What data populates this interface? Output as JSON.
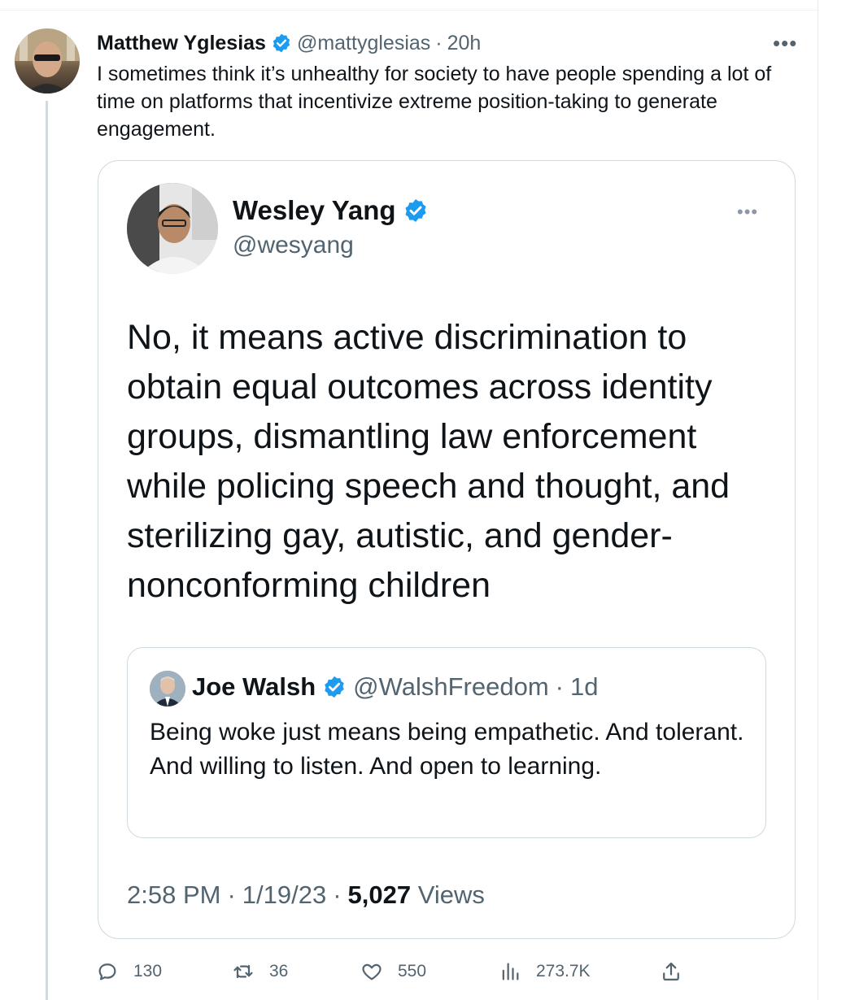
{
  "tweet": {
    "author_name": "Matthew Yglesias",
    "author_handle": "@mattyglesias",
    "separator": "·",
    "time_ago": "20h",
    "more": "•••",
    "text": "I sometimes think it’s unhealthy for society to have people spending a lot of time on platforms that incentivize extreme position-taking to generate engagement."
  },
  "quoted": {
    "author_name": "Wesley Yang",
    "author_handle": "@wesyang",
    "more": "•••",
    "text": "No, it means active discrimination to obtain equal outcomes across identity groups, dismantling law enforcement while policing speech and thought, and sterilizing gay, autistic, and gender-nonconforming children",
    "inner": {
      "author_name": "Joe Walsh",
      "author_handle": "@WalshFreedom",
      "separator": "·",
      "time_ago": "1d",
      "text": "Being woke just means being empathetic. And tolerant. And willing to listen. And open to learning."
    },
    "meta": {
      "time": "2:58 PM",
      "sep1": "·",
      "date": "1/19/23",
      "sep2": "·",
      "views_count": "5,027",
      "views_label": "Views"
    }
  },
  "actions": {
    "replies": "130",
    "retweets": "36",
    "likes": "550",
    "views": "273.7K"
  },
  "colors": {
    "verified": "#1d9bf0",
    "secondary_text": "#536471",
    "border": "#cfd9de"
  },
  "icons": [
    "verified-badge-icon",
    "more-icon",
    "reply-icon",
    "retweet-icon",
    "like-icon",
    "views-icon",
    "share-icon"
  ]
}
